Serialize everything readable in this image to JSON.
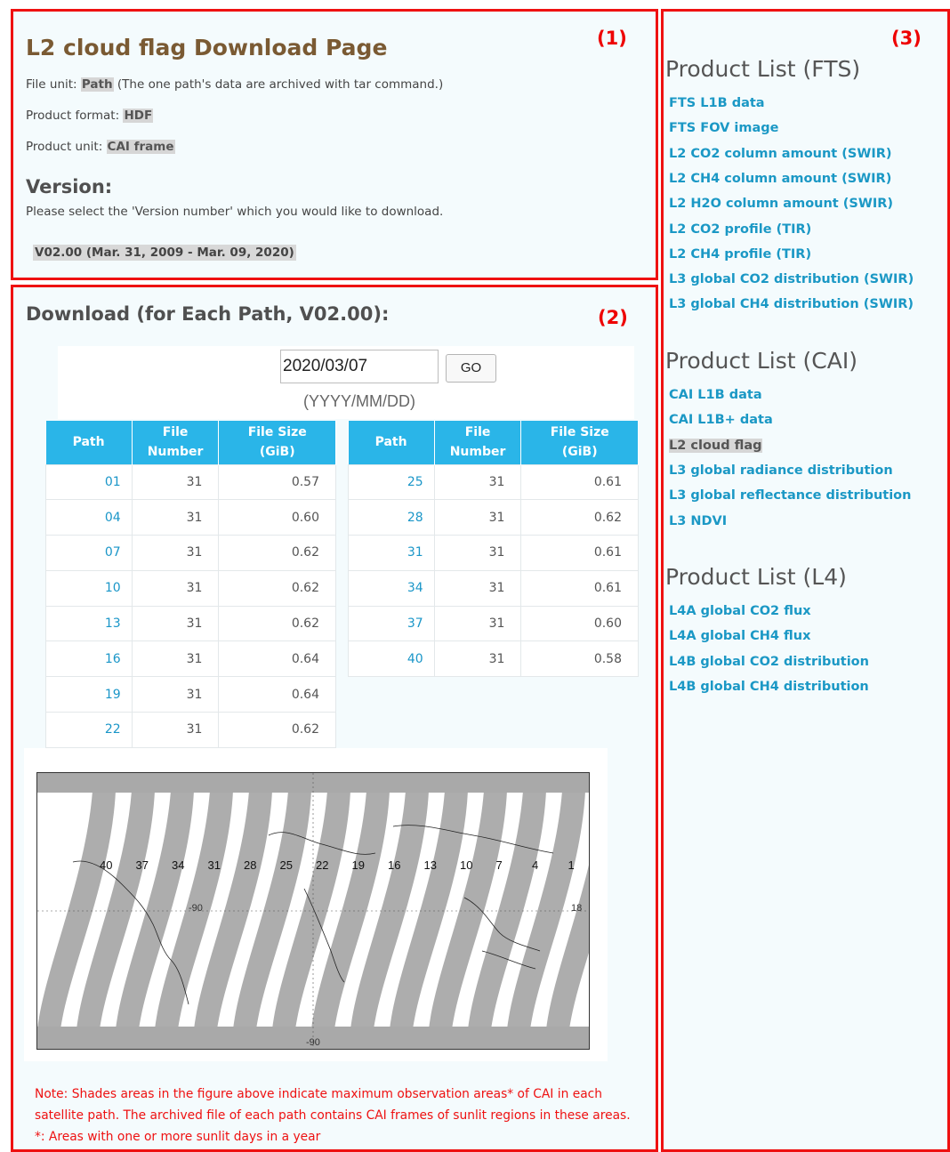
{
  "markers": {
    "box1": "(1)",
    "box2": "(2)",
    "box3": "(3)"
  },
  "header": {
    "title": "L2 cloud flag Download Page",
    "file_unit_label": "File unit: ",
    "file_unit_value": "Path",
    "file_unit_note": " (The one path's data are archived with tar command.)",
    "product_format_label": "Product format: ",
    "product_format_value": "HDF",
    "product_unit_label": "Product unit: ",
    "product_unit_value": "CAI frame"
  },
  "version": {
    "heading": "Version:",
    "desc": "Please select the 'Version number' which you would like to download.",
    "selected": "V02.00 (Mar. 31, 2009 - Mar. 09, 2020)"
  },
  "download": {
    "heading": "Download (for Each Path, V02.00):",
    "date_value": "2020/03/07",
    "go_label": "GO",
    "date_hint": "(YYYY/MM/DD)",
    "columns": [
      "Path",
      "File Number",
      "File Size (GiB)"
    ],
    "table_a": [
      [
        "01",
        "31",
        "0.57"
      ],
      [
        "04",
        "31",
        "0.60"
      ],
      [
        "07",
        "31",
        "0.62"
      ],
      [
        "10",
        "31",
        "0.62"
      ],
      [
        "13",
        "31",
        "0.62"
      ],
      [
        "16",
        "31",
        "0.64"
      ],
      [
        "19",
        "31",
        "0.64"
      ],
      [
        "22",
        "31",
        "0.62"
      ]
    ],
    "table_b": [
      [
        "25",
        "31",
        "0.61"
      ],
      [
        "28",
        "31",
        "0.62"
      ],
      [
        "31",
        "31",
        "0.61"
      ],
      [
        "34",
        "31",
        "0.61"
      ],
      [
        "37",
        "31",
        "0.60"
      ],
      [
        "40",
        "31",
        "0.58"
      ]
    ]
  },
  "map": {
    "path_labels": [
      "40",
      "37",
      "34",
      "31",
      "28",
      "25",
      "22",
      "19",
      "16",
      "13",
      "10",
      "7",
      "4",
      "1"
    ],
    "lon_left": "-90",
    "lon_right": "18",
    "lat_bottom": "-90",
    "swath_color": "#a9a9a9"
  },
  "note": {
    "line1": "Note: Shades areas in the figure above indicate maximum observation areas* of CAI in each",
    "line2": "satellite path. The archived file of each path contains CAI frames of sunlit regions in these areas.",
    "line3": "*: Areas with one or more sunlit days in a year"
  },
  "sidebar": {
    "fts_heading": "Product List (FTS)",
    "fts_items": [
      "FTS L1B data",
      "FTS FOV image",
      "L2 CO2 column amount (SWIR)",
      "L2 CH4 column amount (SWIR)",
      "L2 H2O column amount (SWIR)",
      "L2 CO2 profile (TIR)",
      "L2 CH4 profile (TIR)",
      "L3 global CO2 distribution (SWIR)",
      "L3 global CH4 distribution (SWIR)"
    ],
    "cai_heading": "Product List (CAI)",
    "cai_items": [
      "CAI L1B data",
      "CAI L1B+ data",
      "L2 cloud flag",
      "L3 global radiance distribution",
      "L3 global reflectance distribution",
      "L3 NDVI"
    ],
    "cai_current_index": 2,
    "l4_heading": "Product List (L4)",
    "l4_items": [
      "L4A global CO2 flux",
      "L4A global CH4 flux",
      "L4B global CO2 distribution",
      "L4B global CH4 distribution"
    ]
  },
  "colors": {
    "frame_red": "#ee1111",
    "link_blue": "#1b98c5",
    "table_header": "#2ab5e8",
    "title_brown": "#7a5a33"
  }
}
